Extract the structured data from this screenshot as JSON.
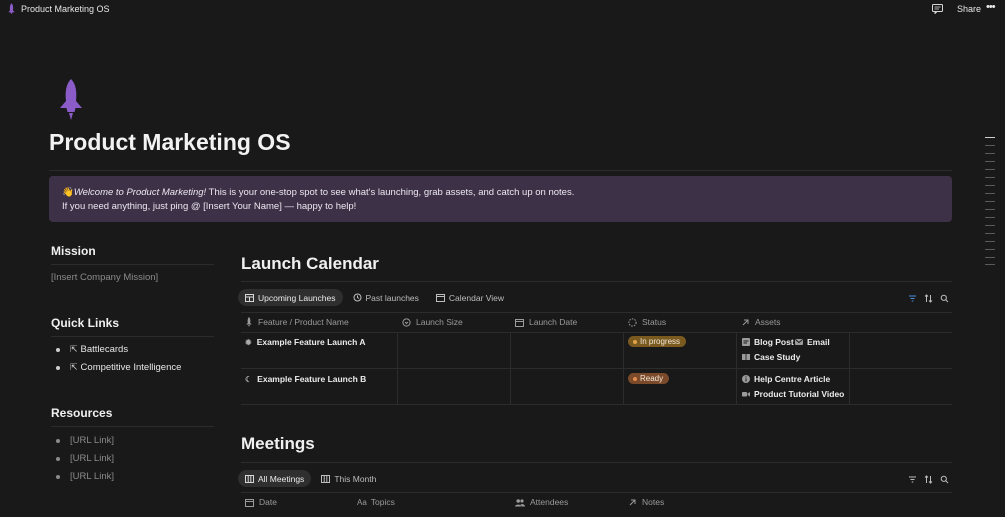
{
  "topbar": {
    "title": "Product Marketing OS",
    "share_label": "Share",
    "more_label": "•••"
  },
  "page": {
    "title": "Product Marketing OS",
    "icon": "rocket-icon",
    "accent_color": "#8b5cc8"
  },
  "callout": {
    "emoji": "👋",
    "welcome": "Welcome to Product Marketing!",
    "line1_rest": " This is your one-stop spot to see what's launching, grab assets, and catch up on notes.",
    "line2": "If you need anything, just ping @ [Insert Your Name] — happy to help!"
  },
  "sidebar": {
    "mission_heading": "Mission",
    "mission_text": "[Insert Company Mission]",
    "quick_links_heading": "Quick Links",
    "quick_links": [
      "Battlecards",
      "Competitive Intelligence"
    ],
    "resources_heading": "Resources",
    "resources": [
      "[URL Link]",
      "[URL Link]",
      "[URL Link]"
    ]
  },
  "launch_calendar": {
    "heading": "Launch Calendar",
    "tabs": [
      "Upcoming Launches",
      "Past launches",
      "Calendar View"
    ],
    "columns": [
      "Feature / Product Name",
      "Launch Size",
      "Launch Date",
      "Status",
      "Assets"
    ],
    "rows": [
      {
        "name": "Example Feature Launch A",
        "status": "In progress",
        "status_color": "#7a5a1f",
        "assets": [
          "Blog Post",
          "Email",
          "Case Study"
        ]
      },
      {
        "name": "Example Feature Launch B",
        "status": "Ready",
        "status_color": "#7a4a2a",
        "assets": [
          "Help Centre Article",
          "Product Tutorial Video"
        ]
      }
    ]
  },
  "meetings": {
    "heading": "Meetings",
    "tabs": [
      "All Meetings",
      "This Month"
    ],
    "columns": [
      "Date",
      "Topics",
      "Attendees",
      "Notes"
    ]
  }
}
